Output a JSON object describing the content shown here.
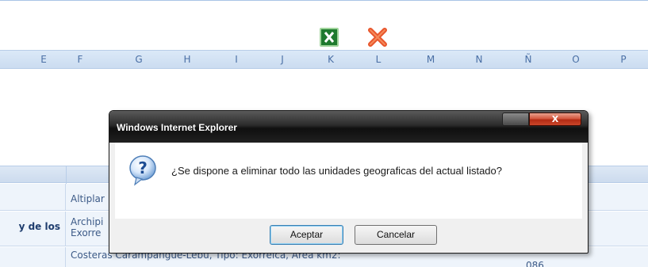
{
  "columns": [
    "E",
    "F",
    "G",
    "H",
    "I",
    "J",
    "K",
    "L",
    "M",
    "N",
    "Ñ",
    "O",
    "P"
  ],
  "toolbar": {
    "excel_icon": "excel-icon",
    "delete_icon": "delete-icon"
  },
  "table": {
    "rows": [
      {
        "left": "",
        "text": "Altiplar"
      },
      {
        "left": "y de los",
        "text": "Archipi\nExorre"
      },
      {
        "left": "",
        "text": "Costeras Carampangue-Lebu, Tipo: Exorreica, Area km2:",
        "num": "086"
      }
    ]
  },
  "dialog": {
    "title": "Windows Internet Explorer",
    "close_glyph": "X",
    "message": "¿Se dispone a eliminar todo las unidades geograficas del actual listado?",
    "ok_label": "Aceptar",
    "cancel_label": "Cancelar",
    "icon": "question-icon"
  },
  "colors": {
    "accent": "#4a6fa5",
    "strip": "#cbdcf0",
    "close": "#c9452a"
  }
}
